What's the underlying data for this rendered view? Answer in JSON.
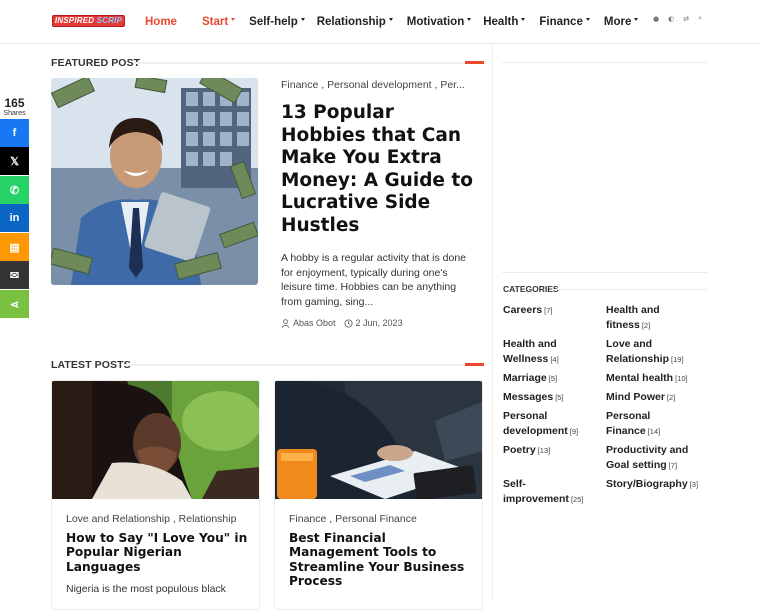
{
  "header": {
    "logo_text_1": "INSPIRED ",
    "logo_text_2": "SCRIP",
    "nav": [
      {
        "label": "Home",
        "active": true,
        "caret": false
      },
      {
        "label": "Start",
        "active": true,
        "caret": true
      },
      {
        "label": "Self-help",
        "active": false,
        "caret": true
      },
      {
        "label": "Relationship",
        "active": false,
        "caret": true
      },
      {
        "label": "Motivation",
        "active": false,
        "caret": true
      },
      {
        "label": "Health",
        "active": false,
        "caret": true
      },
      {
        "label": "Finance",
        "active": false,
        "caret": true
      },
      {
        "label": "More",
        "active": false,
        "caret": true
      }
    ]
  },
  "share": {
    "count": "165",
    "label": "Shares",
    "buttons": [
      {
        "name": "facebook",
        "glyph": "f",
        "color": "#1877f2"
      },
      {
        "name": "x",
        "glyph": "𝕏",
        "color": "#000000"
      },
      {
        "name": "whatsapp",
        "glyph": "✆",
        "color": "#25d366"
      },
      {
        "name": "linkedin",
        "glyph": "in",
        "color": "#0a66c2"
      },
      {
        "name": "sms",
        "glyph": "▤",
        "color": "#ff9800"
      },
      {
        "name": "email",
        "glyph": "✉",
        "color": "#333333"
      },
      {
        "name": "share",
        "glyph": "⋖",
        "color": "#7ac142"
      }
    ]
  },
  "featured": {
    "heading": "FEATURED POST",
    "categories": "Finance , Personal development , Per...",
    "title": "13 Popular Hobbies that Can Make You Extra Money: A Guide to Lucrative Side Hustles",
    "excerpt": "A hobby is a regular activity that is done for enjoyment, typically during one's leisure time. Hobbies can be anything from gaming, sing...",
    "author": "Abas Obot",
    "date": "2 Jun, 2023"
  },
  "latest": {
    "heading": "LATEST POSTS",
    "cards": [
      {
        "categories": "Love and Relationship , Relationship",
        "title": "How to Say \"I Love You\" in Popular Nigerian Languages",
        "excerpt": "Nigeria is the most populous black"
      },
      {
        "categories": "Finance , Personal Finance",
        "title": "Best Financial Management Tools to Streamline Your Business Process",
        "excerpt": ""
      }
    ]
  },
  "sidebar": {
    "categories_heading": "CATEGORIES",
    "categories": [
      {
        "label": "Careers",
        "count": "[7]"
      },
      {
        "label": "Health and fitness",
        "count": "[2]"
      },
      {
        "label": "Health and Wellness",
        "count": "[4]"
      },
      {
        "label": "Love and Relationship",
        "count": "[19]"
      },
      {
        "label": "Marriage",
        "count": "[5]"
      },
      {
        "label": "Mental health",
        "count": "[10]"
      },
      {
        "label": "Messages",
        "count": "[5]"
      },
      {
        "label": "Mind Power",
        "count": "[2]"
      },
      {
        "label": "Personal development",
        "count": "[9]"
      },
      {
        "label": "Personal Finance",
        "count": "[14]"
      },
      {
        "label": "Poetry",
        "count": "[13]"
      },
      {
        "label": "Productivity and Goal setting",
        "count": "[7]"
      },
      {
        "label": "Self-improvement",
        "count": "[25]"
      },
      {
        "label": "Story/Biography",
        "count": "[3]"
      }
    ]
  },
  "colors": {
    "accent": "#e8492c"
  }
}
